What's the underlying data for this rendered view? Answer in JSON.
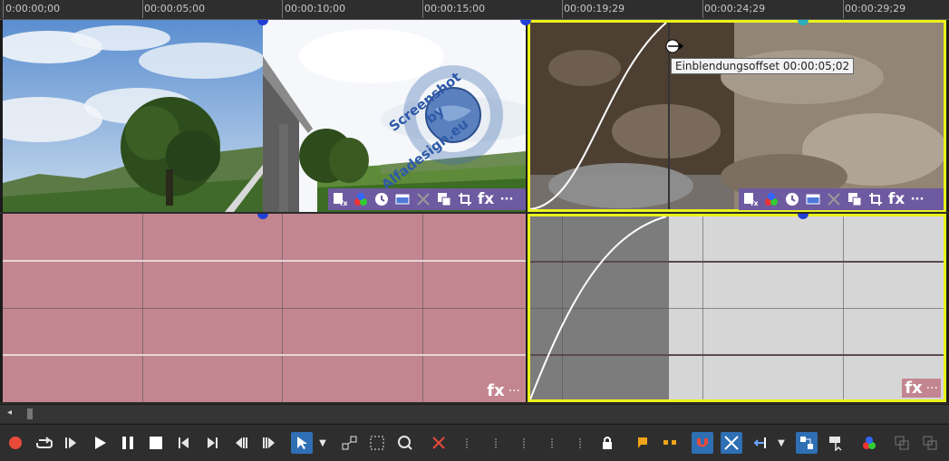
{
  "ruler": {
    "labels": [
      "0:00:00;00",
      "00:00:05;00",
      "00:00:10;00",
      "00:00:15;00",
      "00:00:19;29",
      "00:00:24;29",
      "00:00:29;29"
    ]
  },
  "watermark": {
    "line1": "Screenshot by",
    "line2": "Alfadesign.eu"
  },
  "tooltip": {
    "text": "Einblendungsoffset 00:00:05;02"
  },
  "clip_toolbar_icons": [
    "event-pan-crop-icon",
    "media-fx-icon",
    "clock-icon",
    "generator-icon",
    "stabilize-icon",
    "take-icon",
    "crop-icon",
    "fx-icon",
    "more-icon"
  ],
  "audio_fx": {
    "label": "fx",
    "more": "···"
  },
  "video_fx": {
    "label": "fx",
    "more": "···"
  },
  "colors": {
    "selection": "#e9f21c",
    "audio_pink": "#c38690",
    "audio_light": "#d6d6d6",
    "audio_dark": "#7c7c7c",
    "fx_bar": "#6e5aa0",
    "accent_blue": "#2f6fb4"
  },
  "transport": [
    "record",
    "loop",
    "play-from-start",
    "play",
    "pause",
    "stop",
    "previous",
    "next",
    "prev-frame",
    "next-frame"
  ],
  "edit_tools": [
    "normal-edit-tool",
    "tool-dropdown",
    "envelope-tool",
    "selection-tool",
    "zoom-tool",
    "delete",
    "trim-start",
    "trim-end",
    "split",
    "trim",
    "trim-to-selection",
    "lock",
    "marker",
    "region",
    "snapping",
    "auto-crossfade",
    "auto-ripple",
    "ripple-dropdown",
    "grouping",
    "event-selection",
    "media-fx",
    "next-window",
    "previous-window"
  ]
}
